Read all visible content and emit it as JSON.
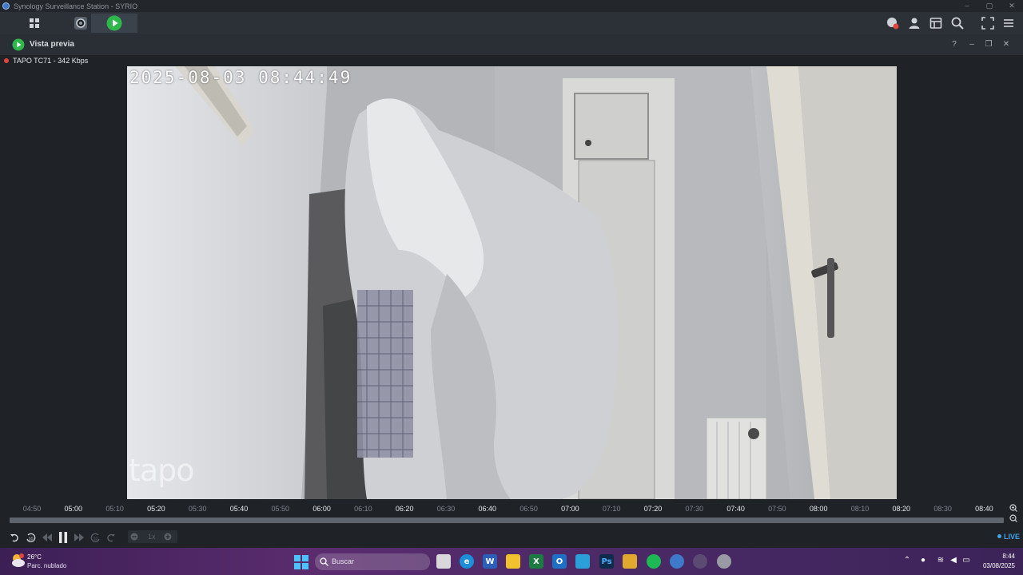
{
  "window": {
    "title": "Synology Surveillance Station - SYRIO",
    "controls": [
      "–",
      "▢",
      "✕"
    ]
  },
  "toolbar": {
    "left_buttons": [
      {
        "name": "main-menu",
        "icon": "grid-icon"
      },
      {
        "name": "camera",
        "icon": "camera-icon"
      },
      {
        "name": "live-view",
        "icon": "play-circle-icon",
        "active": true
      }
    ],
    "right_buttons": [
      "notifications-icon",
      "user-icon",
      "layout-icon",
      "search-icon",
      "fullscreen-icon",
      "menu-icon"
    ]
  },
  "preview": {
    "title": "Vista previa",
    "controls": [
      "?",
      "–",
      "❐",
      "✕"
    ]
  },
  "camera": {
    "label": "TAPO TC71 - 342 Kbps",
    "osd_timestamp": "2025-08-03 08:44:49",
    "watermark": "tapo"
  },
  "timeline": {
    "ticks": [
      {
        "label": "04:50",
        "major": false
      },
      {
        "label": "05:00",
        "major": true
      },
      {
        "label": "05:10",
        "major": false
      },
      {
        "label": "05:20",
        "major": true
      },
      {
        "label": "05:30",
        "major": false
      },
      {
        "label": "05:40",
        "major": true
      },
      {
        "label": "05:50",
        "major": false
      },
      {
        "label": "06:00",
        "major": true
      },
      {
        "label": "06:10",
        "major": false
      },
      {
        "label": "06:20",
        "major": true
      },
      {
        "label": "06:30",
        "major": false
      },
      {
        "label": "06:40",
        "major": true
      },
      {
        "label": "06:50",
        "major": false
      },
      {
        "label": "07:00",
        "major": true
      },
      {
        "label": "07:10",
        "major": false
      },
      {
        "label": "07:20",
        "major": true
      },
      {
        "label": "07:30",
        "major": false
      },
      {
        "label": "07:40",
        "major": true
      },
      {
        "label": "07:50",
        "major": false
      },
      {
        "label": "08:00",
        "major": true
      },
      {
        "label": "08:10",
        "major": false
      },
      {
        "label": "08:20",
        "major": true
      },
      {
        "label": "08:30",
        "major": false
      },
      {
        "label": "08:40",
        "major": true
      }
    ]
  },
  "player": {
    "speed": "1x",
    "live_label": "LIVE"
  },
  "taskbar": {
    "weather_temp": "26°C",
    "weather_desc": "Parc. nublado",
    "search_placeholder": "Buscar",
    "time": "8:44",
    "date": "03/08/2025"
  },
  "colors": {
    "accent": "#3fa4e8",
    "play_green": "#2eb84b",
    "record_red": "#e0463c"
  }
}
